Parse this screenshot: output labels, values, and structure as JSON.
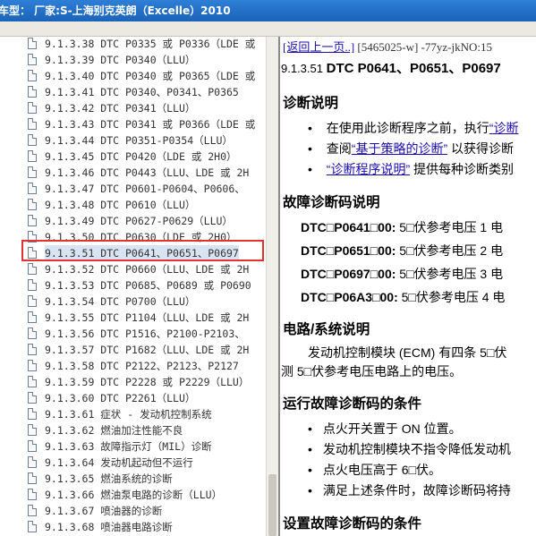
{
  "window": {
    "title": "车型： 厂家:S-上海别克英朗（Excelle）2010"
  },
  "tree": {
    "items": [
      {
        "label": "9.1.3.38 DTC P0335 或 P0336（LDE 或"
      },
      {
        "label": "9.1.3.39 DTC P0340（LLU）"
      },
      {
        "label": "9.1.3.40 DTC P0340 或 P0365（LDE 或"
      },
      {
        "label": "9.1.3.41 DTC P0340、P0341、P0365"
      },
      {
        "label": "9.1.3.42 DTC P0341（LLU）"
      },
      {
        "label": "9.1.3.43 DTC P0341 或 P0366（LDE 或"
      },
      {
        "label": "9.1.3.44 DTC P0351-P0354（LLU）"
      },
      {
        "label": "9.1.3.45 DTC P0420（LDE 或 2H0）"
      },
      {
        "label": "9.1.3.46 DTC P0443（LLU、LDE 或 2H"
      },
      {
        "label": "9.1.3.47 DTC P0601-P0604、P0606、"
      },
      {
        "label": "9.1.3.48 DTC P0610（LLU）"
      },
      {
        "label": "9.1.3.49 DTC P0627-P0629（LLU）"
      },
      {
        "label": "9.1.3.50 DTC P0630（LDE 或 2H0）"
      },
      {
        "label": "9.1.3.51 DTC P0641、P0651、P0697"
      },
      {
        "label": "9.1.3.52 DTC P0660（LLU、LDE 或 2H"
      },
      {
        "label": "9.1.3.53 DTC P0685、P0689 或 P0690"
      },
      {
        "label": "9.1.3.54 DTC P0700（LLU）"
      },
      {
        "label": "9.1.3.55 DTC P1104（LLU、LDE 或 2H"
      },
      {
        "label": "9.1.3.56 DTC P1516、P2100-P2103、"
      },
      {
        "label": "9.1.3.57 DTC P1682（LLU、LDE 或 2H"
      },
      {
        "label": "9.1.3.58 DTC P2122、P2123、P2127"
      },
      {
        "label": "9.1.3.59 DTC P2228 或 P2229（LLU）"
      },
      {
        "label": "9.1.3.60 DTC P2261（LLU）"
      },
      {
        "label": "9.1.3.61 症状 - 发动机控制系统"
      },
      {
        "label": "9.1.3.62 燃油加注性能不良"
      },
      {
        "label": "9.1.3.63 故障指示灯（MIL）诊断"
      },
      {
        "label": "9.1.3.64 发动机起动但不运行"
      },
      {
        "label": "9.1.3.65 燃油系统的诊断"
      },
      {
        "label": "9.1.3.66 燃油泵电路的诊断（LLU）"
      },
      {
        "label": "9.1.3.67 喷油器的诊断"
      },
      {
        "label": "9.1.3.68 喷油器电路诊断"
      }
    ],
    "selected_index": 13
  },
  "doc": {
    "nav_link": "[返回上一页..]",
    "nav_rest": " [5465025-w] -77yz-jkNO:15",
    "title_num": "9.1.3.51 ",
    "title_text": "DTC P0641、P0651、P0697",
    "sec_diag": "诊断说明",
    "diag_b1_pre": "在使用此诊断程序之前，执行",
    "diag_b1_link": "“诊断",
    "diag_b2_pre": "查阅",
    "diag_b2_link": "“基于策略的诊断”",
    "diag_b2_post": " 以获得诊断",
    "diag_b3_link": "“诊断程序说明”",
    "diag_b3_post": " 提供每种诊断类别",
    "sec_dtc": "故障诊断码说明",
    "dtc_items": [
      {
        "code": "DTC□P0641□00:",
        "desc": " 5□伏参考电压 1 电"
      },
      {
        "code": "DTC□P0651□00:",
        "desc": " 5□伏参考电压 2 电"
      },
      {
        "code": "DTC□P0697□00:",
        "desc": " 5□伏参考电压 3 电"
      },
      {
        "code": "DTC□P06A3□00:",
        "desc": " 5□伏参考电压 4 电"
      }
    ],
    "sec_circuit": "电路/系统说明",
    "circuit_p1": "发动机控制模块 (ECM) 有四条 5□伏",
    "circuit_p2": "测 5□伏参考电压电路上的电压。",
    "sec_run": "运行故障诊断码的条件",
    "run_items": [
      "点火开关置于 ON 位置。",
      "发动机控制模块不指令降低发动机",
      "点火电压高于 6□伏。",
      "满足上述条件时，故障诊断码将持"
    ],
    "sec_set": "设置故障诊断码的条件"
  }
}
